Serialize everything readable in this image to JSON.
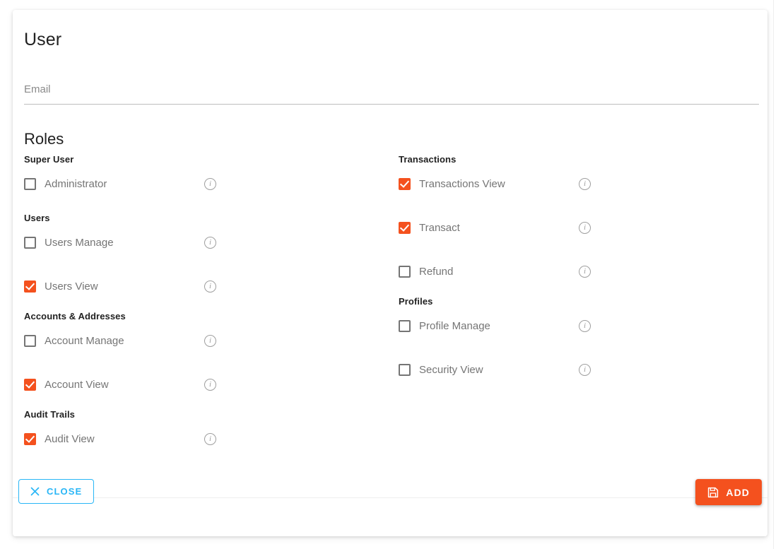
{
  "card": {
    "title": "User"
  },
  "email_field": {
    "placeholder": "Email",
    "value": ""
  },
  "roles": {
    "heading": "Roles",
    "columns": [
      {
        "groups": [
          {
            "name": "Super User",
            "items": [
              {
                "label": "Administrator",
                "checked": false,
                "info": "info-icon"
              }
            ]
          },
          {
            "name": "Users",
            "items": [
              {
                "label": "Users Manage",
                "checked": false,
                "info": "info-icon"
              },
              {
                "label": "Users View",
                "checked": true,
                "info": "info-icon"
              }
            ]
          },
          {
            "name": "Accounts & Addresses",
            "items": [
              {
                "label": "Account Manage",
                "checked": false,
                "info": "info-icon"
              },
              {
                "label": "Account View",
                "checked": true,
                "info": "info-icon"
              }
            ]
          },
          {
            "name": "Audit Trails",
            "items": [
              {
                "label": "Audit View",
                "checked": true,
                "info": "info-icon"
              }
            ]
          }
        ]
      },
      {
        "groups": [
          {
            "name": "Transactions",
            "items": [
              {
                "label": "Transactions View",
                "checked": true,
                "info": "info-icon"
              },
              {
                "label": "Transact",
                "checked": true,
                "info": "info-icon"
              },
              {
                "label": "Refund",
                "checked": false,
                "info": "info-icon"
              }
            ]
          },
          {
            "name": "Profiles",
            "items": [
              {
                "label": "Profile Manage",
                "checked": false,
                "info": "info-icon"
              },
              {
                "label": "Security View",
                "checked": false,
                "info": "info-icon"
              }
            ]
          }
        ]
      }
    ]
  },
  "footer": {
    "close_label": "CLOSE",
    "close_icon": "close-x-icon",
    "add_label": "ADD",
    "add_icon": "save-disk-icon"
  },
  "colors": {
    "accent_orange": "#F4511E",
    "accent_blue": "#29B6F6",
    "label_gray": "#757575",
    "heading_dark": "#212121"
  }
}
